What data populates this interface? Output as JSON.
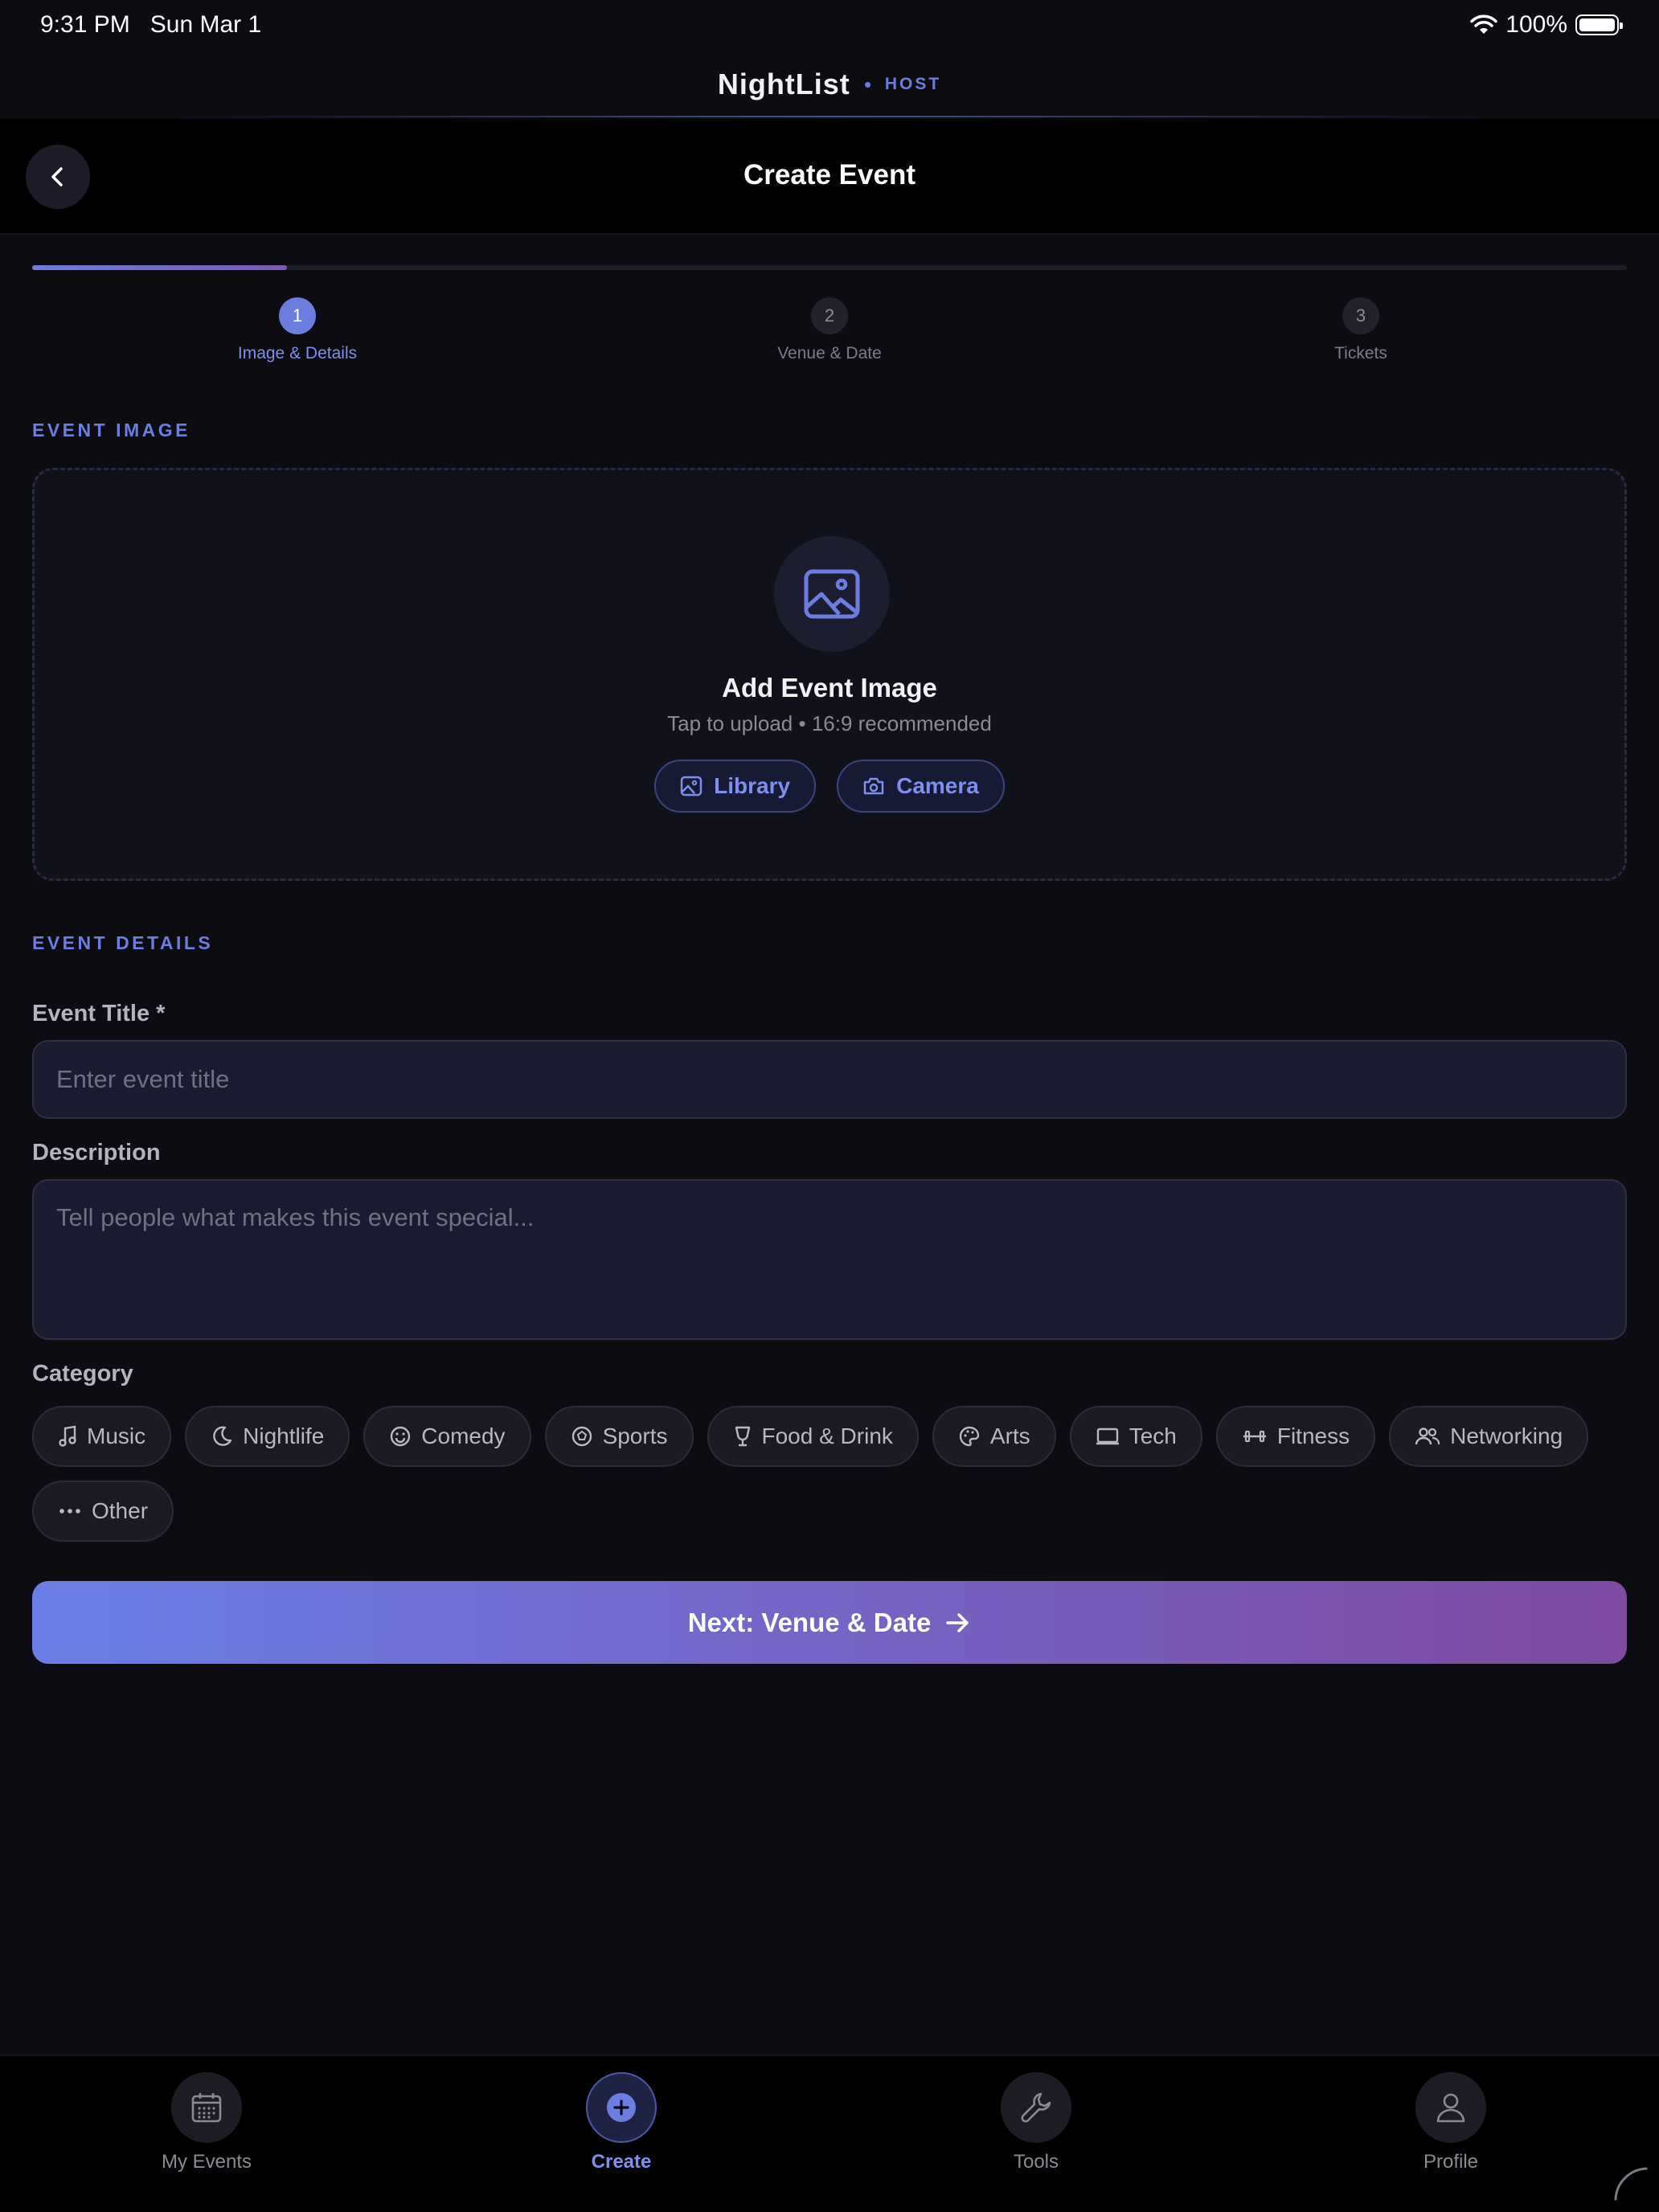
{
  "status": {
    "time": "9:31 PM",
    "date": "Sun Mar 1",
    "battery": "100%"
  },
  "brand": {
    "name": "NightList",
    "tag": "HOST"
  },
  "nav": {
    "title": "Create Event",
    "back_icon": "chevron-left-icon"
  },
  "progress": {
    "fraction": 0.16
  },
  "steps": [
    {
      "number": "1",
      "label": "Image & Details",
      "active": true
    },
    {
      "number": "2",
      "label": "Venue & Date",
      "active": false
    },
    {
      "number": "3",
      "label": "Tickets",
      "active": false
    }
  ],
  "image_section": {
    "label": "EVENT IMAGE",
    "title": "Add Event Image",
    "subtitle": "Tap to upload • 16:9 recommended",
    "library_label": "Library",
    "camera_label": "Camera"
  },
  "details_section": {
    "label": "EVENT DETAILS",
    "title_label": "Event Title *",
    "title_placeholder": "Enter event title",
    "description_label": "Description",
    "description_placeholder": "Tell people what makes this event special...",
    "category_label": "Category"
  },
  "categories": [
    {
      "label": "Music",
      "icon": "music-icon"
    },
    {
      "label": "Nightlife",
      "icon": "moon-icon"
    },
    {
      "label": "Comedy",
      "icon": "smile-icon"
    },
    {
      "label": "Sports",
      "icon": "ball-icon"
    },
    {
      "label": "Food & Drink",
      "icon": "glass-icon"
    },
    {
      "label": "Arts",
      "icon": "palette-icon"
    },
    {
      "label": "Tech",
      "icon": "laptop-icon"
    },
    {
      "label": "Fitness",
      "icon": "dumbbell-icon"
    },
    {
      "label": "Networking",
      "icon": "people-icon"
    },
    {
      "label": "Other",
      "icon": "dots-icon"
    }
  ],
  "next_button": {
    "label": "Next: Venue & Date"
  },
  "tabs": [
    {
      "label": "My Events",
      "icon": "calendar-icon",
      "active": false
    },
    {
      "label": "Create",
      "icon": "plus-circle-icon",
      "active": true
    },
    {
      "label": "Tools",
      "icon": "wrench-icon",
      "active": false
    },
    {
      "label": "Profile",
      "icon": "person-icon",
      "active": false
    }
  ],
  "colors": {
    "accent": "#6b7ee0",
    "gradient_start": "#6b7ee8",
    "gradient_end": "#7e4aa2",
    "background": "#0c0c12"
  }
}
